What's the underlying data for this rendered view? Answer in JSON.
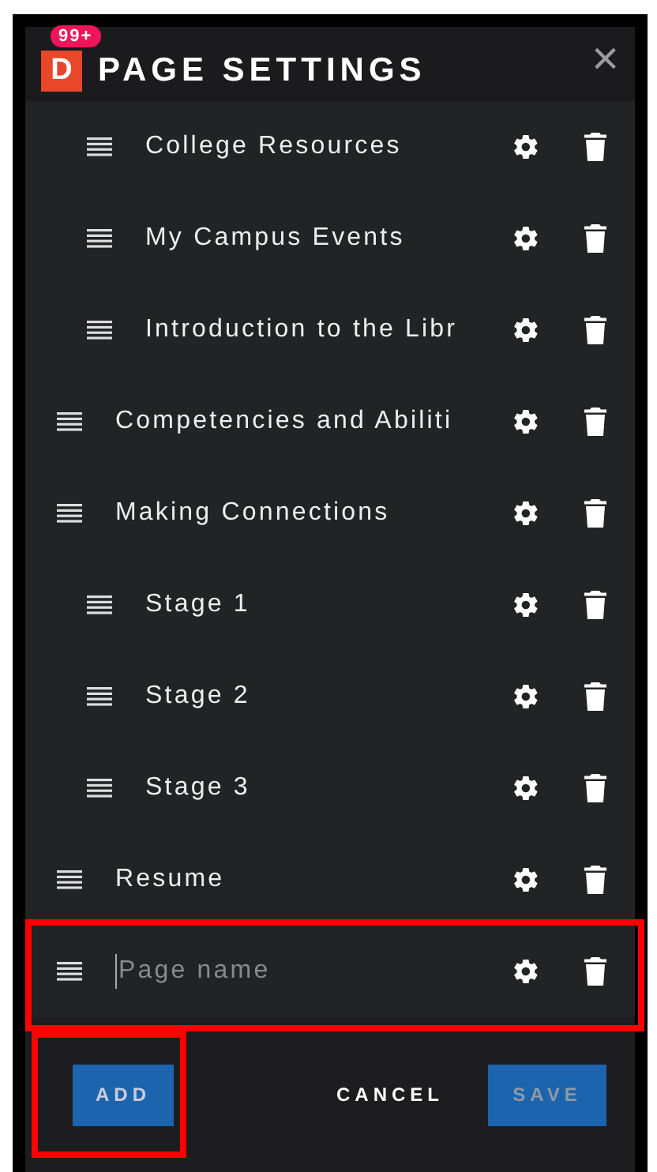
{
  "header": {
    "logo": "D",
    "badge": "99+",
    "title": "PAGE SETTINGS",
    "close": "×"
  },
  "pages": [
    {
      "children": [
        {
          "label": "College Resources"
        },
        {
          "label": "My Campus Events"
        },
        {
          "label": "Introduction to the Libr"
        }
      ]
    },
    {
      "label": "Competencies and Abiliti"
    },
    {
      "label": "Making Connections",
      "children": [
        {
          "label": "Stage 1"
        },
        {
          "label": "Stage 2"
        },
        {
          "label": "Stage 3"
        }
      ]
    },
    {
      "label": "Resume"
    }
  ],
  "new_page": {
    "placeholder": "Page name",
    "highlighted": true
  },
  "footer": {
    "add": {
      "label": "ADD",
      "highlighted": true
    },
    "cancel": {
      "label": "CANCEL"
    },
    "save": {
      "label": "SAVE",
      "disabled": true
    }
  }
}
